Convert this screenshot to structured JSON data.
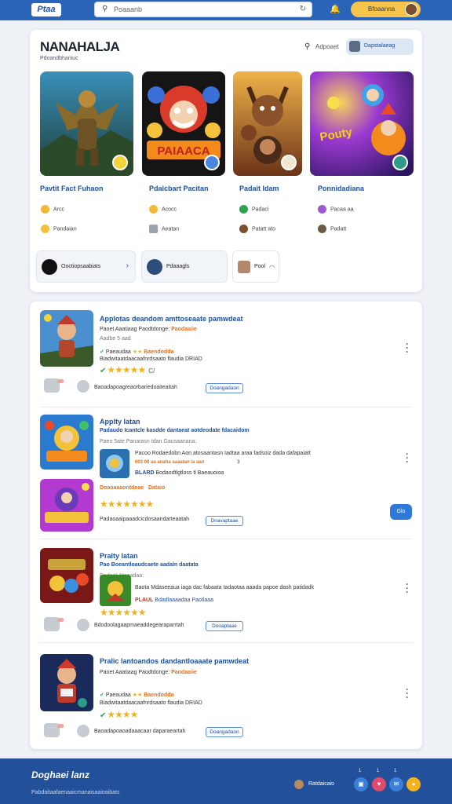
{
  "topbar": {
    "logo": "Ptaa",
    "search_placeholder": "Poaaanb",
    "user_label": "Bfoaanna"
  },
  "featured": {
    "title": "NANAHALJA",
    "subtitle": "Pdoandbhaniuc",
    "developer": "Adpoaet",
    "pill_label": "Dapstalaeag",
    "games": [
      {
        "title": "Pavtit Fact Fuhaon",
        "meta1": "Arcc",
        "meta2": "Pandaian",
        "logo_text": ""
      },
      {
        "title": "Pdaicbart Pacitan",
        "meta1": "Acocc",
        "meta2": "Aeatan",
        "logo_text": "PAIAACA"
      },
      {
        "title": "Padait Idam",
        "meta1": "Padaci",
        "meta2": "Patatt ato",
        "logo_text": ""
      },
      {
        "title": "Ponnidadiana",
        "meta1": "Pacaa aa",
        "meta2": "Padatt",
        "logo_text": "Pouty"
      }
    ],
    "chips": [
      {
        "label": "Ooctiopsaabiats"
      },
      {
        "label": "Pdaaagls"
      },
      {
        "label": "Pool"
      }
    ]
  },
  "list": {
    "items": [
      {
        "title": "Applotas deandom amttoseaate pamwdeat",
        "line1": "Paoet Aaatiaag Paodtdonge:",
        "line1_accent": "Paodaaiie",
        "line2": "Aadbe 5 aad",
        "line3": "Paeaudaa",
        "line3_accent": "Baendodda",
        "line4": "Biadwitaatdaacaafnrdsaato flaudia DRIAD",
        "rating_extra": "C/",
        "button": "Doangadaon",
        "footer_text": "Baoadapoagreaorbariedoaiteaitah"
      },
      {
        "title": "Applty latan",
        "subtitle": "Padaudo Icantcle kasdde dantaeat aotdeodate fdacaidom",
        "line1": "Paeo 5ate Panarasn tdan Gausaanana:",
        "inner1": "Pacoo Rodaedobn Aon atosaantasn Iadtaa araa fadsoiz dada dafapaiatt",
        "inner1_sub": "003 00 aa anaha aaaatan ia aan",
        "inner1_sub2": "3",
        "inner2_accent": "BLARD",
        "inner2": "Bodaodtlgtloss tl Baeauoioa",
        "line3": "Doaoaaaontdeae",
        "line3_accent": "Dataio",
        "button": "Dnavaptaae",
        "blue_button": "Glo",
        "footer_text": "Padaoaaipaaadcicdosaandarteaatah"
      },
      {
        "title": "Pralty latan",
        "subtitle": "Pao Boeantloaudcaete aadaln daatata",
        "line1": "Dadaat Ataeadaa:",
        "inner1": "Baota Mdaseeaua iaga dac fabaata tadaotaa aaada papoe dash patidadk",
        "inner2_accent": "PLAUL",
        "inner2": "Bdadlaaaadaa Paotlaaa",
        "button": "Dooaptaae",
        "footer_text": "Bdodoolagaapmaeaddegearaparrtah"
      },
      {
        "title": "Pralic lantoandos dandantloaaate pamwdeat",
        "line1": "Paoet Aaatiaag Paodtdonge:",
        "line1_accent": "Paodaaiie",
        "line3": "Paeaudaa",
        "line3_accent": "Baendodda",
        "line4": "Biadwitaatdaacaafnrdsaato flaudia DRIAD",
        "button": "Doangadaon",
        "footer_text": "Baoadapoaoadaaacaar daparaeartah"
      }
    ]
  },
  "footer": {
    "title": "Doghaei lanz",
    "subtitle": "Pabdaitaafaenaaicmanaisaaioaibats",
    "user": "Ratdaicaio",
    "badges": [
      "1",
      "1",
      "1"
    ]
  },
  "colors": {
    "primary": "#2a64b8",
    "accent": "#f7c44c",
    "link": "#1d4f9c",
    "star": "#f1b21b"
  }
}
